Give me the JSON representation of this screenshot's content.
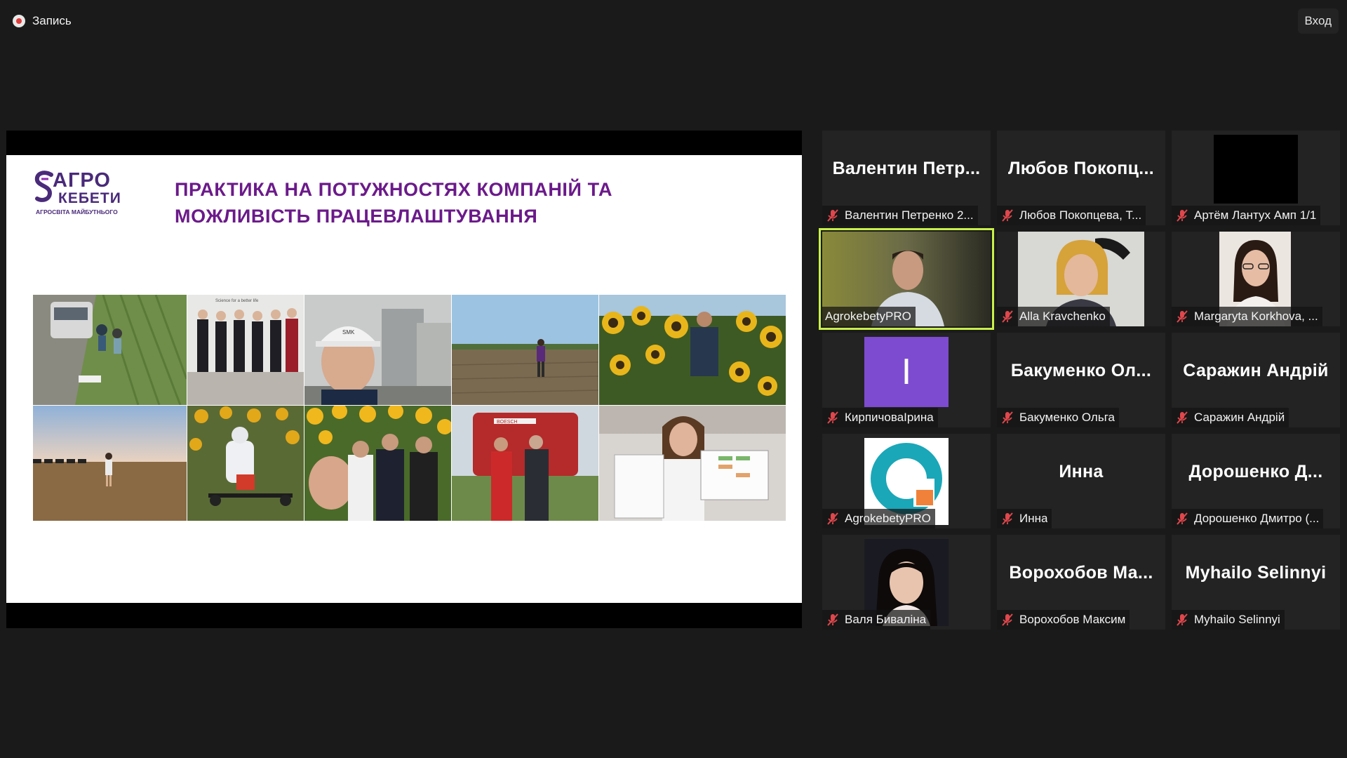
{
  "topbar": {
    "record_label": "Запись",
    "enter_label": "Вход"
  },
  "slide": {
    "logo_line1": "АГРО",
    "logo_line2": "КЕБЕТИ",
    "logo_sub": "АГРОСВІТА МАЙБУТНЬОГО",
    "title": "ПРАКТИКА НА ПОТУЖНОСТЯХ КОМПАНІЙ ТА МОЖЛИВІСТЬ ПРАЦЕВЛАШТУВАННЯ",
    "photo_caption_smk": "SMK",
    "photo_caption_science": "Science for a better life",
    "photo_caption_boesch": "BOESCH"
  },
  "participants": [
    {
      "name": "Валентин Петренко 2...",
      "big": "Валентин  Петр...",
      "muted": true
    },
    {
      "name": "Любов Покопцева, Т...",
      "big": "Любов  Покопц...",
      "muted": true
    },
    {
      "name": "Артём Лантух Амп 1/1",
      "big": "",
      "muted": true
    },
    {
      "name": "AgrokebetyPRO",
      "big": "",
      "muted": false,
      "active": true
    },
    {
      "name": "Alla Kravchenko",
      "big": "",
      "muted": true
    },
    {
      "name": "Margaryta Korkhova, ...",
      "big": "",
      "muted": true
    },
    {
      "name": "КирпичоваІрина",
      "big": "",
      "muted": true,
      "avatar_letter": "I"
    },
    {
      "name": "Бакуменко Ольга",
      "big": "Бакуменко  Ол...",
      "muted": true
    },
    {
      "name": "Саражин Андрій",
      "big": "Саражин Андрій",
      "muted": true
    },
    {
      "name": "AgrokebetyPRO",
      "big": "",
      "muted": true
    },
    {
      "name": "Инна",
      "big": "Инна",
      "muted": true
    },
    {
      "name": "Дорошенко Дмитро (...",
      "big": "Дорошенко  Д...",
      "muted": true
    },
    {
      "name": "Валя Бивалiна",
      "big": "",
      "muted": true
    },
    {
      "name": "Ворохобов Максим",
      "big": "Ворохобов  Ма...",
      "muted": true
    },
    {
      "name": "Myhailo Selinnyi",
      "big": "Myhailo Selinnyi",
      "muted": true
    }
  ],
  "colors": {
    "accent_active": "#c8f04a",
    "mic_muted": "#e0474c",
    "slide_title": "#6b1a8a"
  },
  "icons": {
    "record": "record-icon",
    "mic": "mic-muted-icon"
  }
}
